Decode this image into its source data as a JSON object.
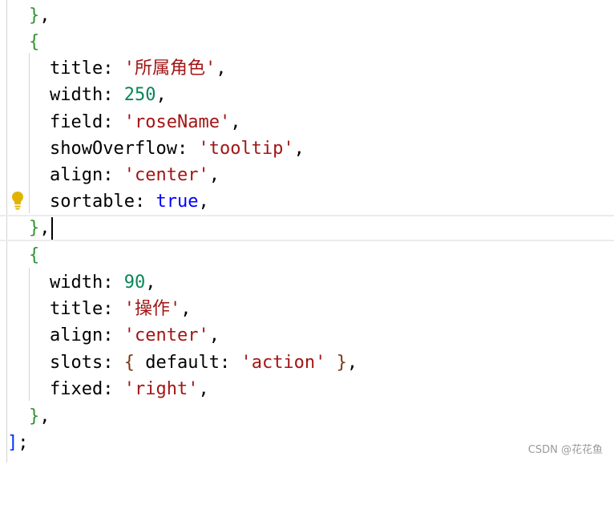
{
  "editor": {
    "lines": [
      {
        "close_brace": "}",
        "comma": ","
      },
      {
        "open_brace": "{"
      },
      {
        "key": "title",
        "colon": ": ",
        "value": "'所属角色'",
        "comma": ","
      },
      {
        "key": "width",
        "colon": ": ",
        "value": "250",
        "comma": ","
      },
      {
        "key": "field",
        "colon": ": ",
        "value": "'roseName'",
        "comma": ","
      },
      {
        "key": "showOverflow",
        "colon": ": ",
        "value": "'tooltip'",
        "comma": ","
      },
      {
        "key": "align",
        "colon": ": ",
        "value": "'center'",
        "comma": ","
      },
      {
        "key": "sortable",
        "colon": ": ",
        "value": "true",
        "comma": ","
      },
      {
        "close_brace": "}",
        "comma": ","
      },
      {
        "open_brace": "{"
      },
      {
        "key": "width",
        "colon": ": ",
        "value": "90",
        "comma": ","
      },
      {
        "key": "title",
        "colon": ": ",
        "value": "'操作'",
        "comma": ","
      },
      {
        "key": "align",
        "colon": ": ",
        "value": "'center'",
        "comma": ","
      },
      {
        "key": "slots",
        "colon": ": ",
        "open": "{ ",
        "inner_key": "default",
        "inner_colon": ": ",
        "value": "'action'",
        "close": " }",
        "comma": ","
      },
      {
        "key": "fixed",
        "colon": ": ",
        "value": "'right'",
        "comma": ","
      },
      {
        "close_brace": "}",
        "comma": ","
      },
      {
        "close_bracket": "]",
        "semicolon": ";"
      }
    ]
  },
  "watermark": "CSDN @花花鱼",
  "colors": {
    "string": "#a31515",
    "number": "#098658",
    "keyword": "#0000ff",
    "bracket_level2": "#319331",
    "bracket_level1": "#0431fa",
    "bulb": "#e1b300"
  },
  "icons": [
    "lightbulb-icon"
  ]
}
